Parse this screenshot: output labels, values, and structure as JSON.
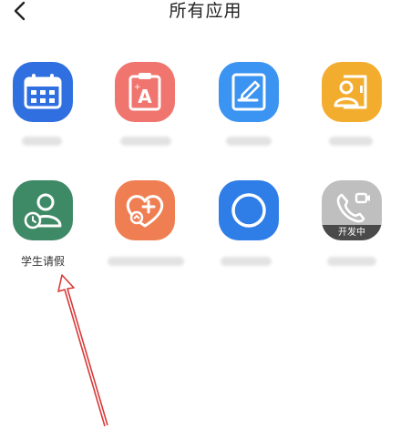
{
  "header": {
    "title": "所有应用",
    "back_icon": "chevron-left-icon"
  },
  "apps": [
    {
      "icon": "calendar-icon",
      "color": "#2f6fe0",
      "label": ""
    },
    {
      "icon": "clipboard-a-icon",
      "color": "#f0756f",
      "label": ""
    },
    {
      "icon": "document-edit-icon",
      "color": "#3b93f2",
      "label": ""
    },
    {
      "icon": "user-card-icon",
      "color": "#f3ad2e",
      "label": ""
    },
    {
      "icon": "student-clock-icon",
      "color": "#3f8a66",
      "label": "学生请假"
    },
    {
      "icon": "heart-plus-icon",
      "color": "#ef7f52",
      "label": ""
    },
    {
      "icon": "circle-icon",
      "color": "#2f7ee8",
      "label": ""
    },
    {
      "icon": "video-call-icon",
      "color": "#bfbfbf",
      "label": "",
      "badge": "开发中"
    }
  ],
  "annotation_color": "#d93a3a"
}
